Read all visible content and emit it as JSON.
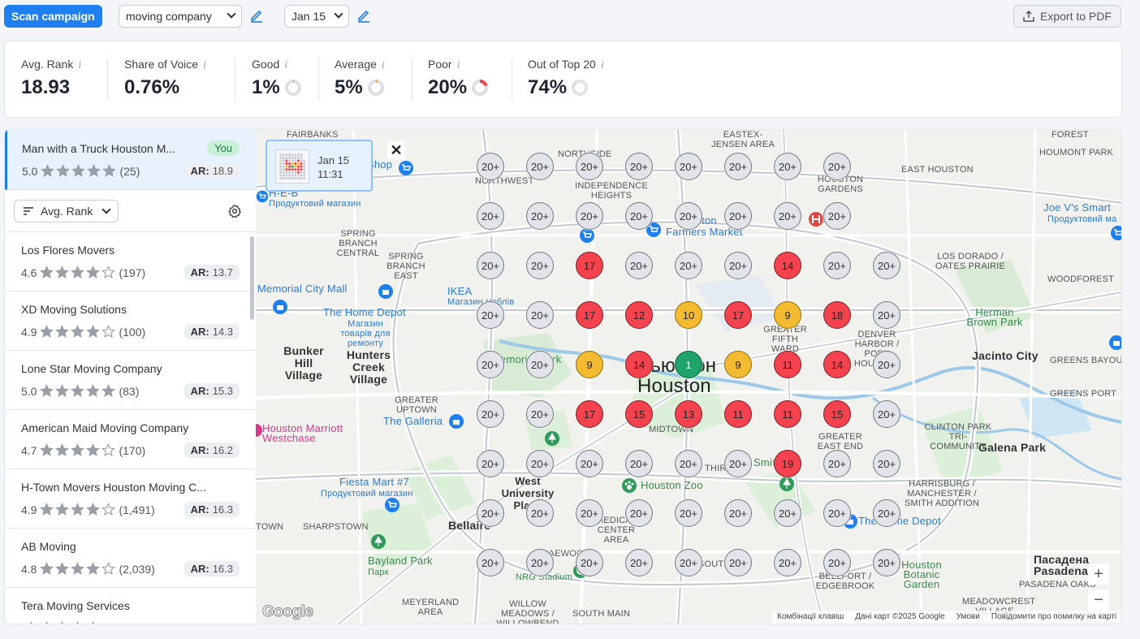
{
  "toolbar": {
    "scan_label": "Scan campaign",
    "keyword": "moving company",
    "date": "Jan 15",
    "export_label": "Export to PDF"
  },
  "stats": {
    "avg_rank": {
      "label": "Avg. Rank",
      "value": "18.93"
    },
    "share_of_voice": {
      "label": "Share of Voice",
      "value": "0.76%"
    },
    "good": {
      "label": "Good",
      "value": "1%",
      "fraction": 0.01
    },
    "average": {
      "label": "Average",
      "value": "5%",
      "fraction": 0.05
    },
    "poor": {
      "label": "Poor",
      "value": "20%",
      "fraction": 0.2
    },
    "out_top20": {
      "label": "Out of Top 20",
      "value": "74%",
      "fraction": 0.74
    },
    "info_glyph": "i"
  },
  "colors": {
    "accent": "#1d7ff0",
    "good": "#1ea36a",
    "average": "#f4bb30",
    "poor": "#f5424f",
    "out": "#e3e4ea"
  },
  "own_business": {
    "name": "Man with a Truck Houston M...",
    "badge": "You",
    "rating": "5.0",
    "stars": 5,
    "reviews": "(25)",
    "ar_label": "AR:",
    "ar": "18.9"
  },
  "sort": {
    "label": "Avg. Rank"
  },
  "competitors": [
    {
      "name": "Los Flores Movers",
      "rating": "4.6",
      "stars": 4,
      "reviews": "(197)",
      "ar": "13.7"
    },
    {
      "name": "XD Moving Solutions",
      "rating": "4.9",
      "stars": 4,
      "reviews": "(100)",
      "ar": "14.3"
    },
    {
      "name": "Lone Star Moving Company",
      "rating": "5.0",
      "stars": 5,
      "reviews": "(83)",
      "ar": "15.3"
    },
    {
      "name": "American Maid Moving Company",
      "rating": "4.7",
      "stars": 4,
      "reviews": "(170)",
      "ar": "16.2"
    },
    {
      "name": "H-Town Movers Houston Moving C...",
      "rating": "4.9",
      "stars": 4,
      "reviews": "(1,491)",
      "ar": "16.3"
    },
    {
      "name": "AB Moving",
      "rating": "4.8",
      "stars": 4,
      "reviews": "(2,039)",
      "ar": "16.3"
    },
    {
      "name": "Tera Moving Services",
      "rating": "",
      "stars": 4,
      "reviews": "",
      "ar": ""
    }
  ],
  "map": {
    "popup": {
      "date": "Jan 15",
      "time": "11:31"
    },
    "close": "✕",
    "zoom_in": "+",
    "zoom_out": "−",
    "google": "Google",
    "attribution": [
      "Комбінації клавіш",
      "Дані карт ©2025 Google",
      "Умови",
      "Повідомити про помилку на карті"
    ],
    "grid": [
      [
        "20+",
        "20+",
        "20+",
        "20+",
        "20+",
        "20+",
        "20+",
        "20+"
      ],
      [
        "20+",
        "20+",
        "20+",
        "20+",
        "20+",
        "20+",
        "20+",
        "20+"
      ],
      [
        "20+",
        "20+",
        "17",
        "20+",
        "20+",
        "20+",
        "14",
        "20+",
        "20+"
      ],
      [
        "20+",
        "20+",
        "17",
        "12",
        "10",
        "17",
        "9",
        "18",
        "20+"
      ],
      [
        "20+",
        "20+",
        "9",
        "14",
        "1",
        "9",
        "11",
        "14",
        "20+"
      ],
      [
        "20+",
        "20+",
        "17",
        "15",
        "13",
        "11",
        "11",
        "15",
        "20+"
      ],
      [
        "20+",
        "20+",
        "20+",
        "20+",
        "20+",
        "20+",
        "19",
        "20+",
        "20+"
      ],
      [
        "20+",
        "20+",
        "20+",
        "20+",
        "20+",
        "20+",
        "20+",
        "20+",
        "20+"
      ],
      [
        "20+",
        "20+",
        "20+",
        "20+",
        "20+",
        "20+",
        "20+",
        "20+",
        "20+"
      ]
    ],
    "labels": {
      "fairbanks": "FAIRBANKS",
      "northwest": "NORTHWEST",
      "northside": "NORTHSIDE",
      "independence": "INDEPENDENCE HEIGHTS",
      "eastex": "EASTEX-JENSEN AREA",
      "forest": "FOREST",
      "houmont": "HOUMONT PARK",
      "east_houston": "EAST HOUSTON",
      "houston_gardens": "HOUSTON GARDENS",
      "heb": "H-E-B",
      "heb_sub": "Продуктовий магазин",
      "shop": "Shop",
      "spring_branch_central": "SPRING BRANCH CENTRAL",
      "farmers": "Farmers Market",
      "houston_fm": "Houston",
      "joe": "Joe V's Smart",
      "joe_sub": "Продуктовий ма",
      "spring_branch_east": "SPRING BRANCH EAST",
      "los_dorado": "LOS DORADO / OATES PRAIRIE",
      "memorial": "Memorial City Mall",
      "ikea": "IKEA",
      "ikea_sub": "Магазин меблів",
      "woodforest": "WOODFOREST",
      "home_depot": "The Home Depot",
      "home_depot_sub": "Магазин товарів для ремонту",
      "herman": "Herman Brown Park",
      "greater_fifth": "GREATER FIFTH WARD",
      "denver": "DENVER HARBOR / PORT HOUSTON",
      "bunker": "Bunker Hill Village",
      "hunters": "Hunters Creek Village",
      "memorial_park": "Memorial Park",
      "jacinto": "Jacinto City",
      "greens_bayou": "GREENS BAYOU",
      "houston_ua": "Хьюстон",
      "houston": "Houston",
      "greater_uptown": "GREATER UPTOWN",
      "galleria": "The Galleria",
      "greens_port": "GREENS PORT",
      "marriott": "Houston Marriott Westchase",
      "midtown": "MIDTOWN",
      "clinton": "CLINTON PARK TRI-COMMUNITY",
      "greater_east_end": "GREATER EAST END",
      "galena": "Galena Park",
      "fiesta": "Fiesta Mart #7",
      "fiesta_sub": "Продуктовий магазин",
      "west_u": "West University Place",
      "zoo": "Houston Zoo",
      "third": "THIRD",
      "smith": "Smith",
      "harrisburg": "HARRISBURG / MANCHESTER / SMITH ADDITION",
      "sharpstown": "SHARPSTOWN",
      "bellaire": "Bellaire",
      "medical": "MEDICAL CENTER AREA",
      "home_depot2": "The Home Depot",
      "bayland": "Bayland Park",
      "bayland_sub": "Парк",
      "nrg": "NRG Stadium",
      "pasadena_ua": "Пасадена",
      "pasadena": "Pasadena",
      "botanic": "Houston Botanic Garden",
      "pasadena_oaks": "PASADENA OAKS",
      "south": "SOUTH",
      "edgebrook": "BELLFORT / EDGEBROOK",
      "braeswood": "BRAEWOOD",
      "meyerland": "MEYERLAND AREA",
      "willow": "WILLOW MEADOWS / WILLOWBEND AREA",
      "south_main": "SOUTH MAIN",
      "meadowcrest": "MEADOWCREST VILLAGE",
      "ewton": "TOWN"
    }
  }
}
